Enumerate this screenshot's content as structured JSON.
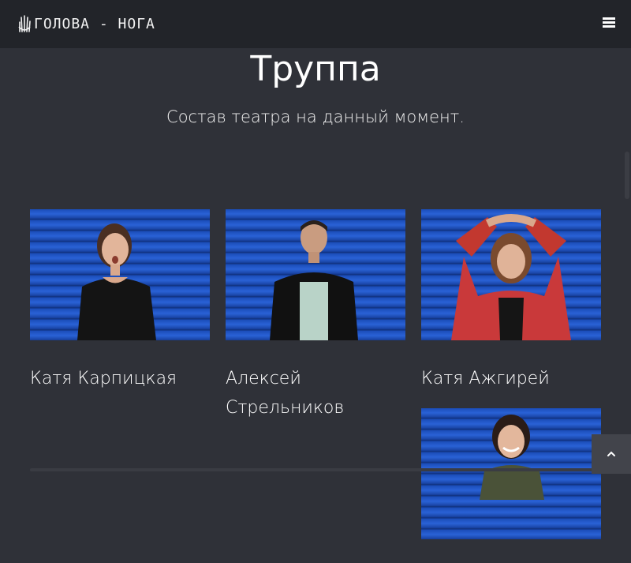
{
  "navbar": {
    "logo_text": "ГОЛОВА - НОГА",
    "menu_icon": "hamburger-menu-icon"
  },
  "section": {
    "title": "Труппа",
    "subtitle": "Состав театра на данный момент."
  },
  "members": [
    {
      "name": "Катя Карпицкая"
    },
    {
      "name": "Алексей Стрельников"
    },
    {
      "name": "Катя Ажгирей"
    },
    {
      "name": ""
    }
  ],
  "back_to_top_icon": "chevron-up-icon",
  "colors": {
    "background": "#2f3138",
    "navbar": "#222429",
    "photo_wall": "#2155c4"
  }
}
